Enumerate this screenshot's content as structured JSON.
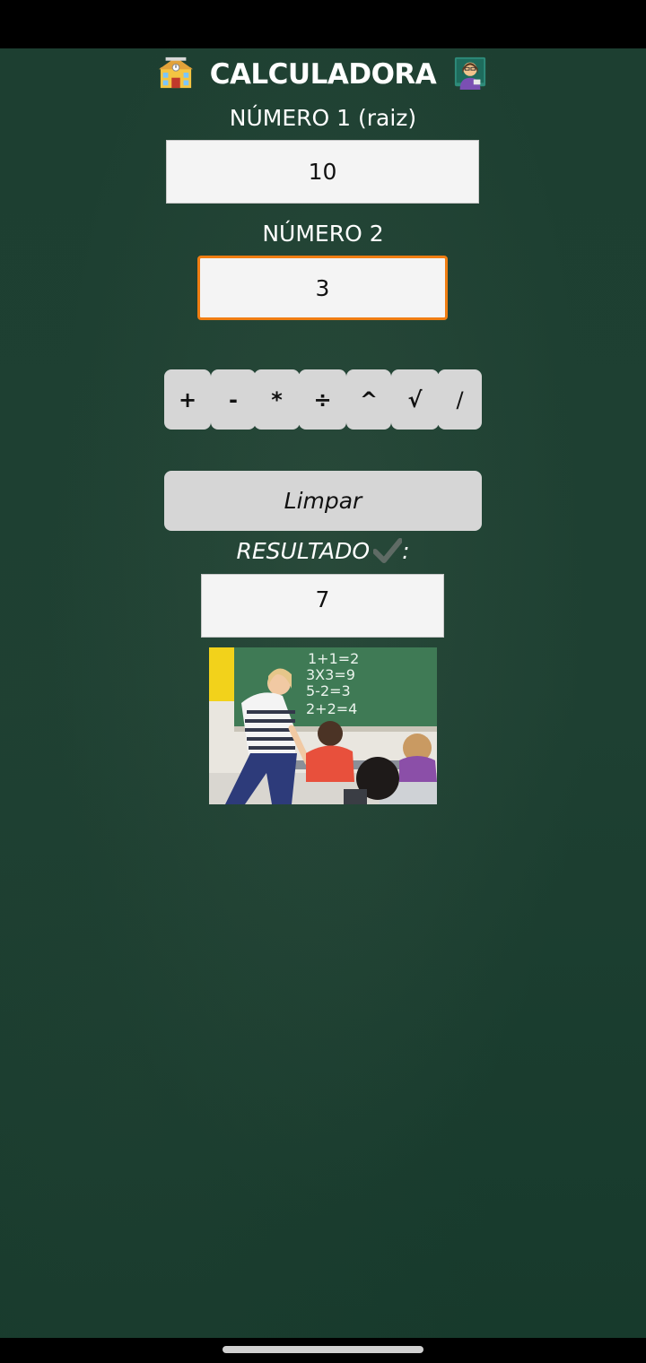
{
  "app": {
    "title": "CALCULADORA",
    "title_icon_left": "school-icon",
    "title_icon_right": "teacher-icon"
  },
  "form": {
    "num1_label": "NÚMERO 1 (raiz)",
    "num1_value": "10",
    "num2_label": "NÚMERO 2",
    "num2_value": "3"
  },
  "operations": [
    "+",
    "-",
    "*",
    "÷",
    "^",
    "√",
    "/"
  ],
  "clear_label": "Limpar",
  "result": {
    "label": "RESULTADO",
    "label_suffix": ":",
    "icon": "check-mark-icon",
    "value": "7"
  },
  "photo": {
    "chalkboard_lines": [
      "1+1=2",
      "3X3=9",
      "5-2=3",
      "2+2=4"
    ]
  },
  "colors": {
    "background": "#1e4032",
    "focus_border": "#f07d12",
    "button": "#d6d6d6",
    "field": "#f4f4f4"
  }
}
